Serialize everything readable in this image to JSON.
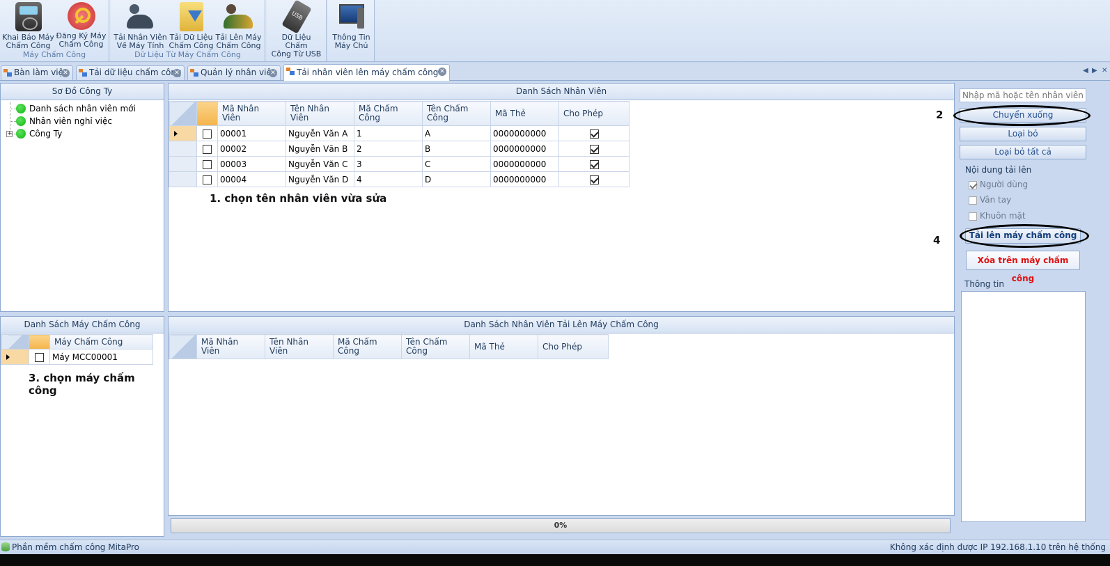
{
  "ribbon": {
    "groups": [
      {
        "title": "Máy Chấm Công",
        "buttons": [
          {
            "label": "Khai Báo Máy\nChấm Công",
            "icon": "fingerprint-device-icon"
          },
          {
            "label": "Đăng Ký Máy\nChấm Công",
            "icon": "key-icon"
          }
        ]
      },
      {
        "title": "Dữ Liệu Từ Máy Chấm Công",
        "buttons": [
          {
            "label": "Tải Nhân Viên\nVề Máy Tính",
            "icon": "people-download-icon"
          },
          {
            "label": "Tải Dữ Liệu\nChấm Công",
            "icon": "folder-download-icon"
          },
          {
            "label": "Tải Lên Máy\nChấm Công",
            "icon": "people-upload-icon"
          }
        ]
      },
      {
        "title": "",
        "buttons": [
          {
            "label": "Dữ Liệu Chấm\nCông Từ USB",
            "icon": "usb-icon"
          }
        ]
      },
      {
        "title": "",
        "buttons": [
          {
            "label": "Thông Tin\nMáy Chủ",
            "icon": "server-computer-icon"
          }
        ]
      }
    ]
  },
  "tabs": [
    {
      "label": "Bàn làm việc",
      "active": false
    },
    {
      "label": "Tải dữ liệu chấm công",
      "active": false
    },
    {
      "label": "Quản lý nhân viên",
      "active": false
    },
    {
      "label": "Tải nhân viên lên máy chấm công",
      "active": true
    }
  ],
  "company_tree": {
    "title": "Sơ Đồ Công Ty",
    "items": [
      "Danh sách nhân viên mới",
      "Nhân viên nghỉ việc",
      "Công Ty"
    ]
  },
  "employee_list": {
    "title": "Danh Sách Nhân Viên",
    "columns": [
      "Mã Nhân\nViên",
      "Tên Nhân\nViên",
      "Mã Chấm\nCông",
      "Tên Chấm\nCông",
      "Mã Thẻ",
      "Cho Phép"
    ],
    "rows": [
      {
        "selected": true,
        "checked": false,
        "id": "00001",
        "name": "Nguyễn Văn A",
        "code": "1",
        "tname": "A",
        "card": "0000000000",
        "allowed": true
      },
      {
        "selected": false,
        "checked": false,
        "id": "00002",
        "name": "Nguyễn Văn B",
        "code": "2",
        "tname": "B",
        "card": "0000000000",
        "allowed": true
      },
      {
        "selected": false,
        "checked": false,
        "id": "00003",
        "name": "Nguyễn Văn C",
        "code": "3",
        "tname": "C",
        "card": "0000000000",
        "allowed": true
      },
      {
        "selected": false,
        "checked": false,
        "id": "00004",
        "name": "Nguyễn Văn D",
        "code": "4",
        "tname": "D",
        "card": "0000000000",
        "allowed": true
      }
    ]
  },
  "machine_list": {
    "title": "Danh Sách Máy Chấm Công",
    "column": "Máy Chấm Công",
    "rows": [
      {
        "selected": true,
        "checked": false,
        "name": "Máy MCC00001"
      }
    ]
  },
  "upload_list": {
    "title": "Danh Sách Nhân Viên Tải Lên Máy Chấm Công",
    "columns": [
      "Mã Nhân\nViên",
      "Tên Nhân\nViên",
      "Mã Chấm\nCông",
      "Tên Chấm\nCông",
      "Mã Thẻ",
      "Cho Phép"
    ]
  },
  "annotations": {
    "step1": "1. chọn tên nhân viên vừa sửa",
    "step2": "2",
    "step3": "3. chọn máy chấm công",
    "step4": "4"
  },
  "right_panel": {
    "search_placeholder": "Nhập mã hoặc tên nhân viên",
    "move_down": "Chuyển xuống",
    "remove": "Loại bỏ",
    "remove_all": "Loại bỏ tất cả",
    "upload_content_label": "Nội dung tải lên",
    "options": [
      {
        "label": "Người dùng",
        "checked": true
      },
      {
        "label": "Vân tay",
        "checked": false
      },
      {
        "label": "Khuôn mặt",
        "checked": false
      }
    ],
    "upload_button": "Tải lên máy chấm công",
    "delete_button": "Xóa trên máy chấm công",
    "info_label": "Thông tin"
  },
  "progress": {
    "value": 0,
    "text": "0%"
  },
  "status": {
    "left": "Phần mềm chấm công MitaPro",
    "right": "Không xác định được IP 192.168.1.10 trên hệ thống"
  },
  "colors": {
    "accent": "#1e4b8c",
    "danger": "#e01010",
    "selected_row": "#f9d9a3"
  }
}
